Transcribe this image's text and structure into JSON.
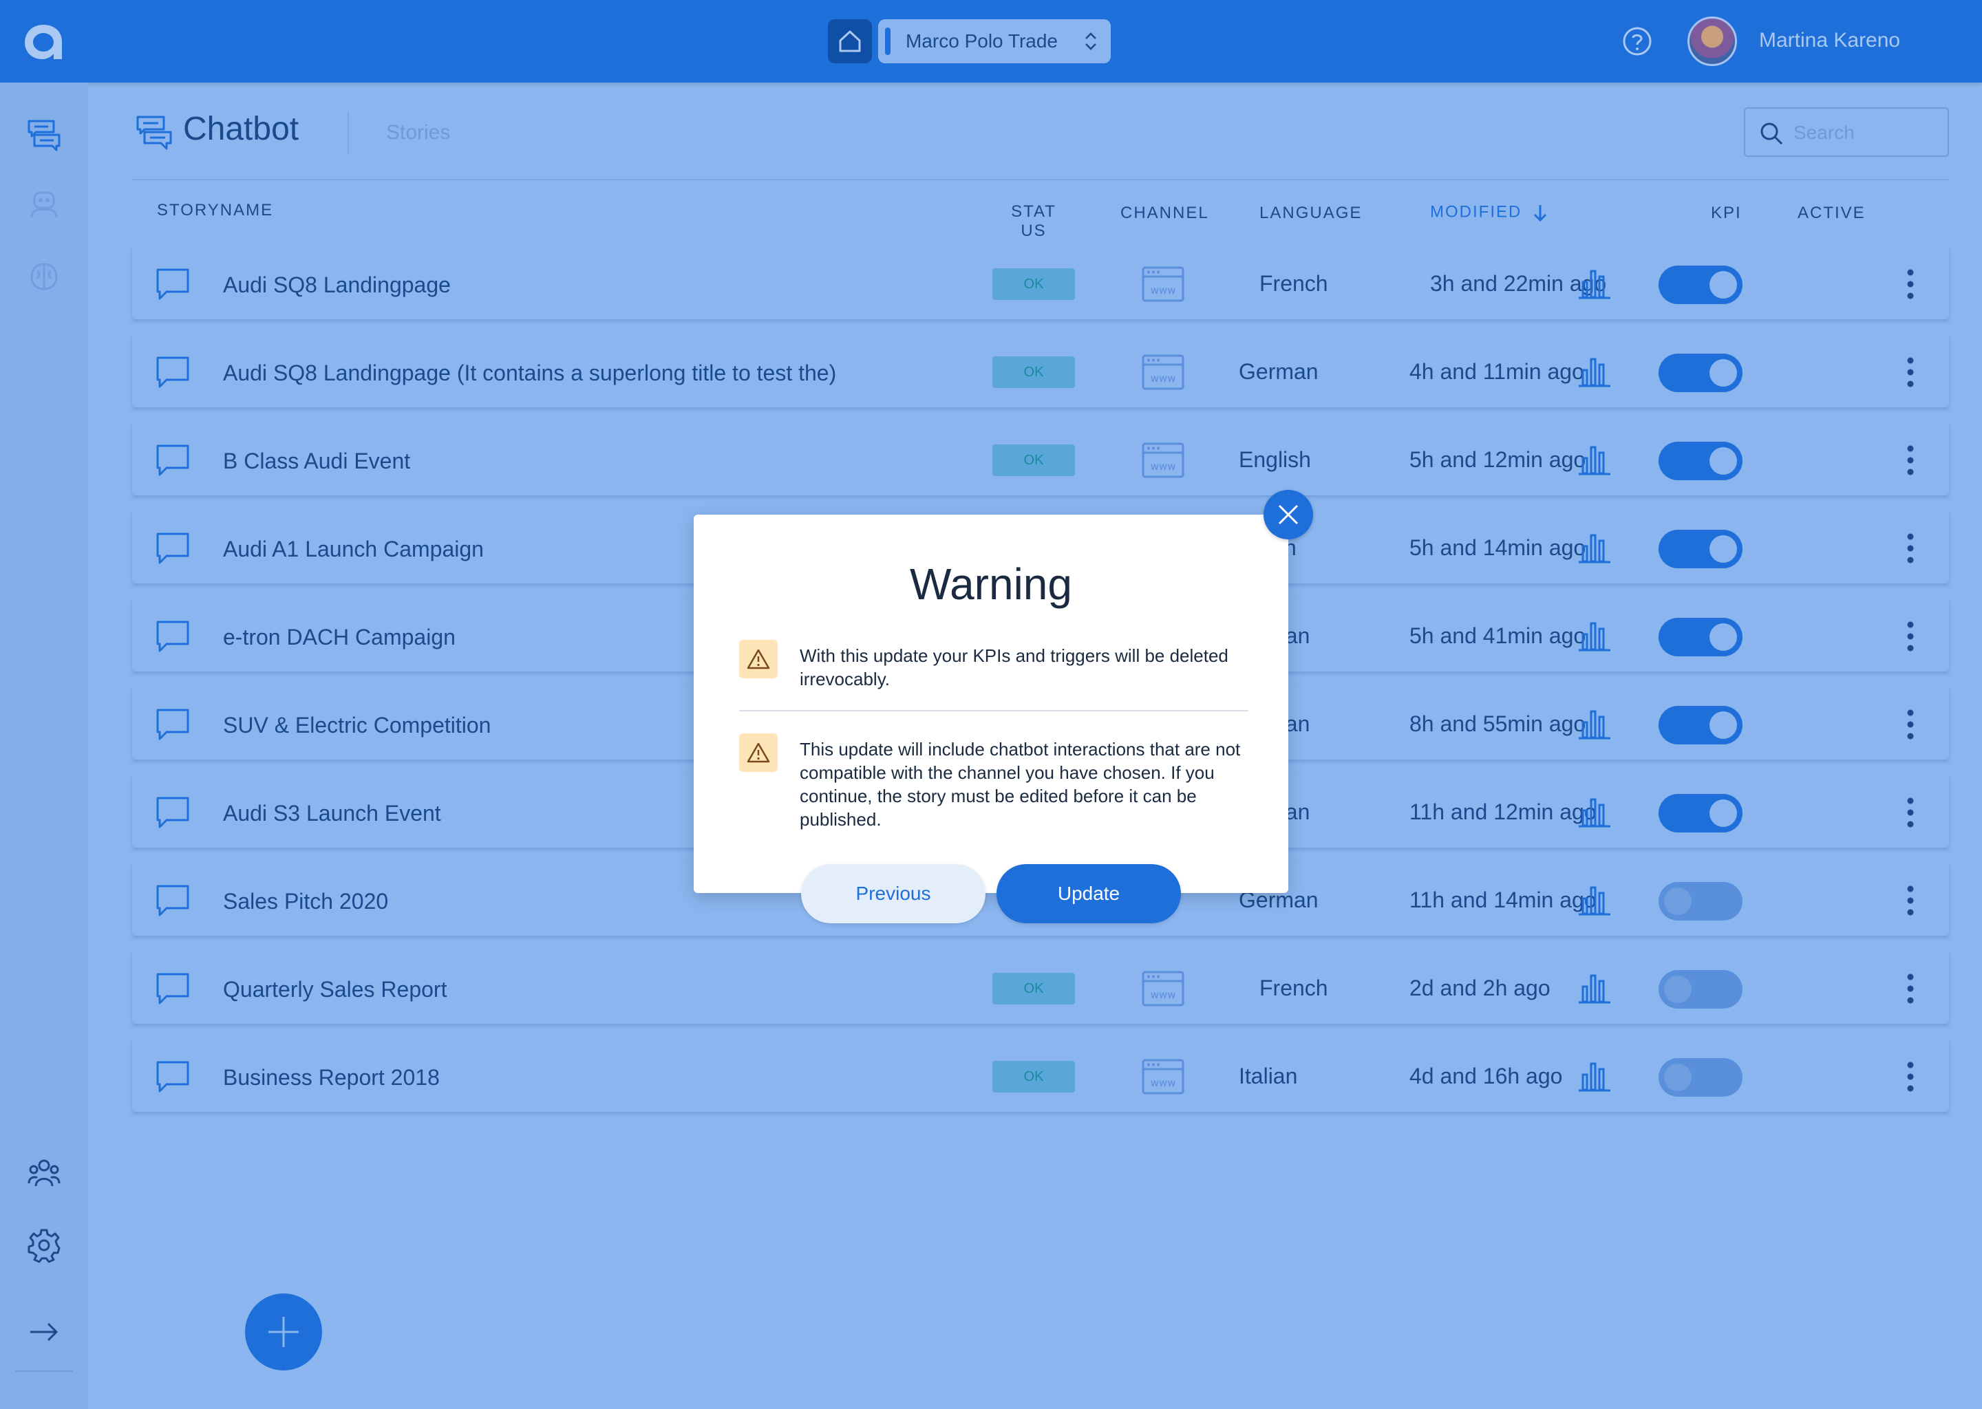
{
  "topbar": {
    "org_name": "Marco Polo Trade",
    "user_name": "Martina Kareno"
  },
  "header": {
    "title": "Chatbot",
    "tab_stories": "Stories",
    "search_placeholder": "Search"
  },
  "columns": {
    "storyname": "STORYNAME",
    "status": "STATUS",
    "channel": "CHANNEL",
    "language": "LANGUAGE",
    "modified": "MODIFIED",
    "kpi": "KPI",
    "active": "ACTIVE"
  },
  "rows": [
    {
      "name": "Audi SQ8 Landingpage",
      "status": "OK",
      "language": "French",
      "modified": "3h and 22min ago",
      "active": true
    },
    {
      "name": "Audi SQ8 Landingpage (It contains a superlong title to test the)",
      "status": "OK",
      "language": "German",
      "modified": "4h and 11min ago",
      "active": true
    },
    {
      "name": "B Class Audi Event",
      "status": "OK",
      "language": "English",
      "modified": "5h and 12min ago",
      "active": true
    },
    {
      "name": "Audi A1 Launch Campaign",
      "status": "",
      "language": "sh",
      "modified": "5h and 14min ago",
      "active": true
    },
    {
      "name": "e-tron DACH Campaign",
      "status": "",
      "language": "nan",
      "modified": "5h and 41min ago",
      "active": true
    },
    {
      "name": "SUV & Electric Competition",
      "status": "",
      "language": "nan",
      "modified": "8h and 55min ago",
      "active": true
    },
    {
      "name": "Audi S3 Launch Event",
      "status": "",
      "language": "nan",
      "modified": "11h and 12min ago",
      "active": true
    },
    {
      "name": "Sales Pitch 2020",
      "status": "",
      "language": "German",
      "modified": "11h and 14min ago",
      "active": false
    },
    {
      "name": "Quarterly Sales Report",
      "status": "OK",
      "language": "French",
      "modified": "2d and 2h ago",
      "active": false
    },
    {
      "name": "Business Report 2018",
      "status": "OK",
      "language": "Italian",
      "modified": "4d and 16h ago",
      "active": false
    }
  ],
  "modal": {
    "title": "Warning",
    "warning_1": "With this update your KPIs and triggers will be deleted irrevocably.",
    "warning_2": "This update will include chatbot interactions that are not compatible with the channel you have chosen. If you continue, the story must be edited before it can be published.",
    "previous_label": "Previous",
    "update_label": "Update"
  },
  "colors": {
    "brand": "#1e6fd9",
    "background": "#8ab5ef",
    "warning_bg": "#fde5b8"
  }
}
